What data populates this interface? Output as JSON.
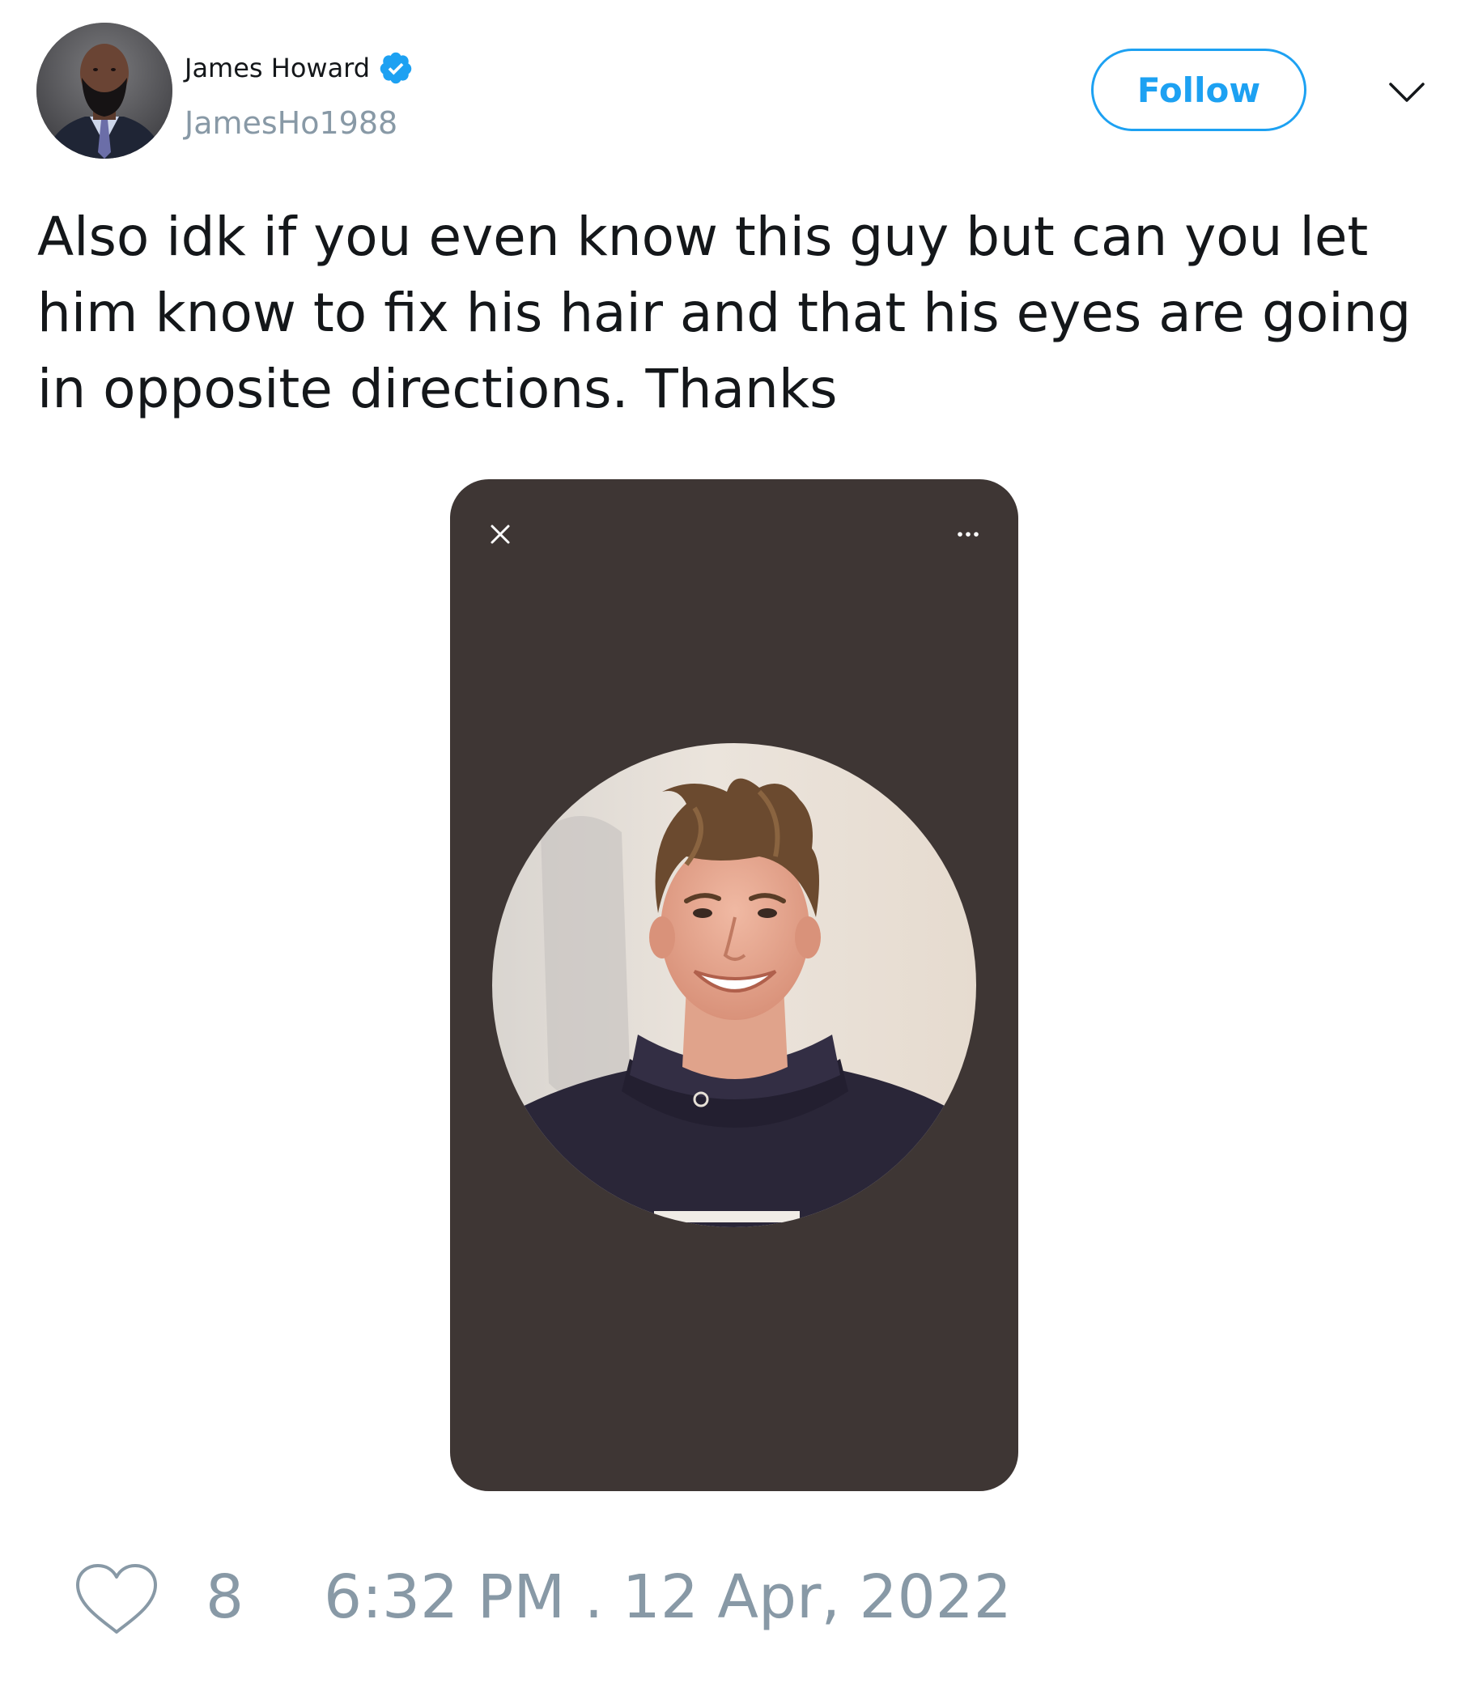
{
  "author": {
    "display_name": "James Howard",
    "handle": "JamesHo1988",
    "verified": true
  },
  "header": {
    "follow_label": "Follow"
  },
  "tweet": {
    "text": "Also idk if you even know this guy but can you let him know to fix his hair and that his eyes are going in opposite directions. Thanks"
  },
  "media": {
    "background_color": "#3e3634",
    "close_icon": "close-icon",
    "more_icon": "more-options-icon"
  },
  "footer": {
    "like_count": "8",
    "timestamp": "6:32 PM . 12 Apr, 2022"
  },
  "colors": {
    "accent": "#1da1f2",
    "muted": "#8899a6",
    "text": "#14171a"
  }
}
